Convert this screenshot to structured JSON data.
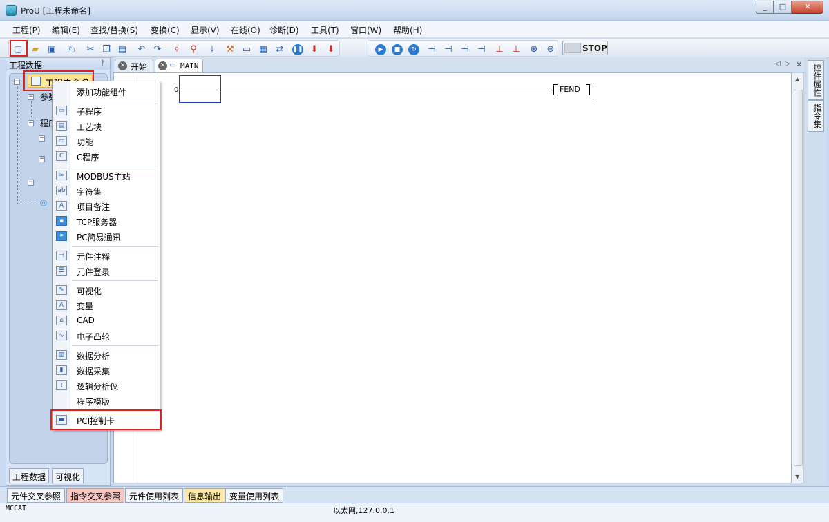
{
  "window": {
    "title": "ProU [工程未命名]",
    "min": "_",
    "max": "□",
    "close": "✕"
  },
  "menu": [
    "工程(P)",
    "编辑(E)",
    "查找/替换(S)",
    "变换(C)",
    "显示(V)",
    "在线(O)",
    "诊断(D)",
    "工具(T)",
    "窗口(W)",
    "帮助(H)"
  ],
  "toolbar": {
    "stop_label": "STOP"
  },
  "left_panel": {
    "title": "工程数据",
    "pin": "ᚠ",
    "root": "工程未命名",
    "node_params": "参数",
    "node_program": "程序",
    "tabs": [
      "工程数据",
      "可视化"
    ]
  },
  "editor": {
    "tabs": [
      "开始",
      "MAIN"
    ],
    "row_number": "0",
    "fend": "FEND"
  },
  "right_tabs": [
    "控件属性",
    "指令集"
  ],
  "bottom_tabs": [
    "元件交叉参照",
    "指令交叉参照",
    "元件使用列表",
    "信息输出",
    "变量使用列表"
  ],
  "status": {
    "left": "MCCAT",
    "center": "以太网,127.0.0.1"
  },
  "context_menu": {
    "header": "添加功能组件",
    "groups": [
      [
        "子程序",
        "工艺块",
        "功能",
        "C程序"
      ],
      [
        "MODBUS主站",
        "字符集",
        "项目备注",
        "TCP服务器",
        "PC简易通讯"
      ],
      [
        "元件注释",
        "元件登录"
      ],
      [
        "可视化",
        "变量",
        "CAD",
        "电子凸轮"
      ],
      [
        "数据分析",
        "数据采集",
        "逻辑分析仪",
        "程序模版"
      ],
      [
        "PCI控制卡"
      ]
    ]
  }
}
